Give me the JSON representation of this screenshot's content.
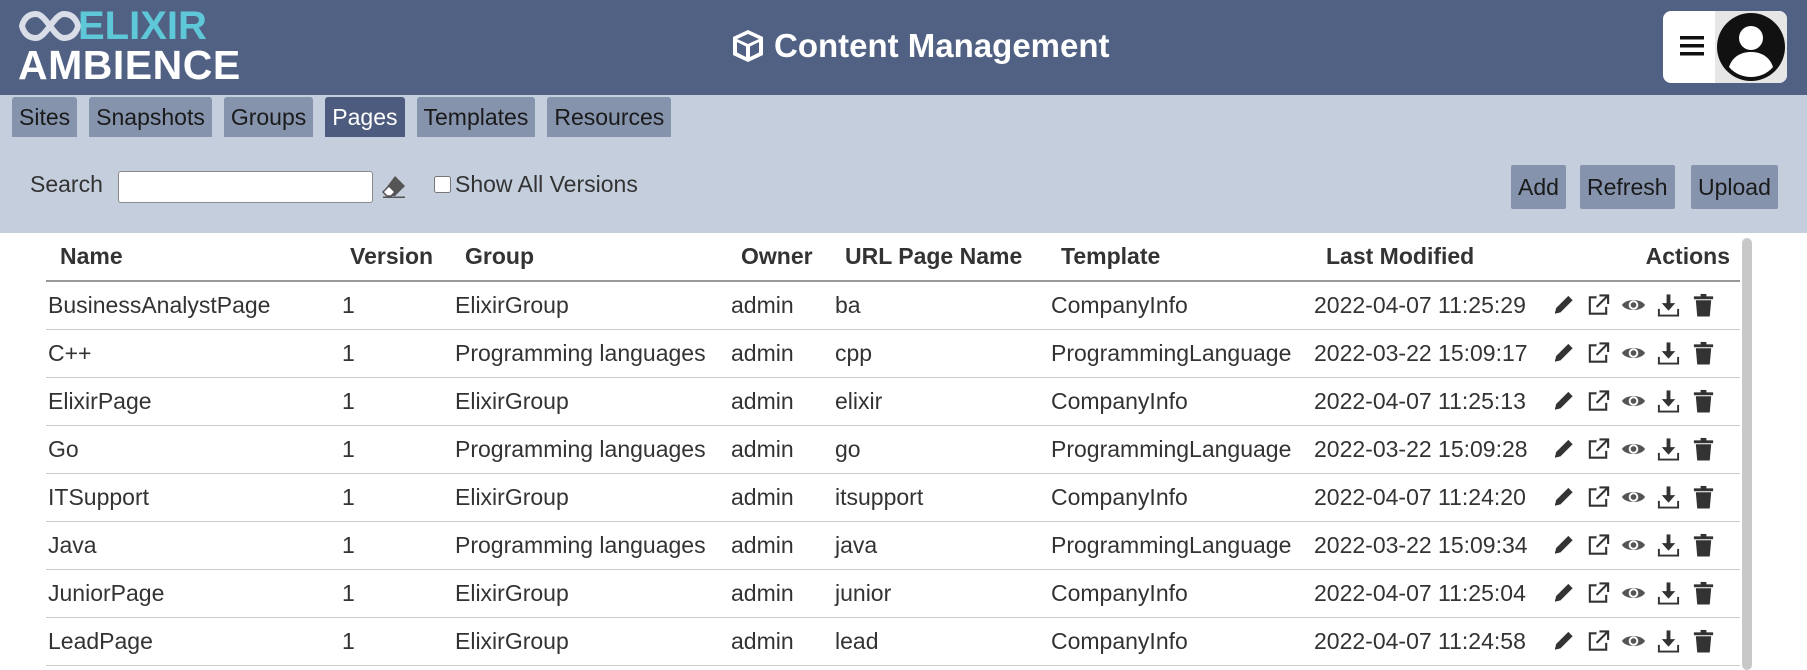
{
  "header": {
    "logo_top": "ELIXIR",
    "logo_bottom": "AMBIENCE",
    "title": "Content Management",
    "title_icon": "cube-icon",
    "menu_icon": "hamburger-icon",
    "avatar_icon": "user-avatar-icon"
  },
  "tabs": [
    {
      "label": "Sites",
      "active": false
    },
    {
      "label": "Snapshots",
      "active": false
    },
    {
      "label": "Groups",
      "active": false
    },
    {
      "label": "Pages",
      "active": true
    },
    {
      "label": "Templates",
      "active": false
    },
    {
      "label": "Resources",
      "active": false
    }
  ],
  "toolbar": {
    "search_label": "Search",
    "search_value": "",
    "clear_icon": "eraser-icon",
    "show_all_label": "Show All Versions",
    "show_all_checked": false,
    "add_label": "Add",
    "refresh_label": "Refresh",
    "upload_label": "Upload"
  },
  "table": {
    "columns": [
      "Name",
      "Version",
      "Group",
      "Owner",
      "URL Page Name",
      "Template",
      "Last Modified",
      "Actions"
    ],
    "action_icons": [
      "pencil-icon",
      "external-link-icon",
      "eye-icon",
      "download-icon",
      "trash-icon"
    ],
    "rows": [
      [
        "BusinessAnalystPage",
        "1",
        "ElixirGroup",
        "admin",
        "ba",
        "CompanyInfo",
        "2022-04-07 11:25:29"
      ],
      [
        "C++",
        "1",
        "Programming languages",
        "admin",
        "cpp",
        "ProgrammingLanguage",
        "2022-03-22 15:09:17"
      ],
      [
        "ElixirPage",
        "1",
        "ElixirGroup",
        "admin",
        "elixir",
        "CompanyInfo",
        "2022-04-07 11:25:13"
      ],
      [
        "Go",
        "1",
        "Programming languages",
        "admin",
        "go",
        "ProgrammingLanguage",
        "2022-03-22 15:09:28"
      ],
      [
        "ITSupport",
        "1",
        "ElixirGroup",
        "admin",
        "itsupport",
        "CompanyInfo",
        "2022-04-07 11:24:20"
      ],
      [
        "Java",
        "1",
        "Programming languages",
        "admin",
        "java",
        "ProgrammingLanguage",
        "2022-03-22 15:09:34"
      ],
      [
        "JuniorPage",
        "1",
        "ElixirGroup",
        "admin",
        "junior",
        "CompanyInfo",
        "2022-04-07 11:25:04"
      ],
      [
        "LeadPage",
        "1",
        "ElixirGroup",
        "admin",
        "lead",
        "CompanyInfo",
        "2022-04-07 11:24:58"
      ]
    ]
  },
  "colors": {
    "header_bg": "#516184",
    "band_bg": "#c5cedd",
    "tab_bg": "#8593ad",
    "tab_active_bg": "#4c5b7e",
    "logo_accent": "#5ec8d8"
  }
}
